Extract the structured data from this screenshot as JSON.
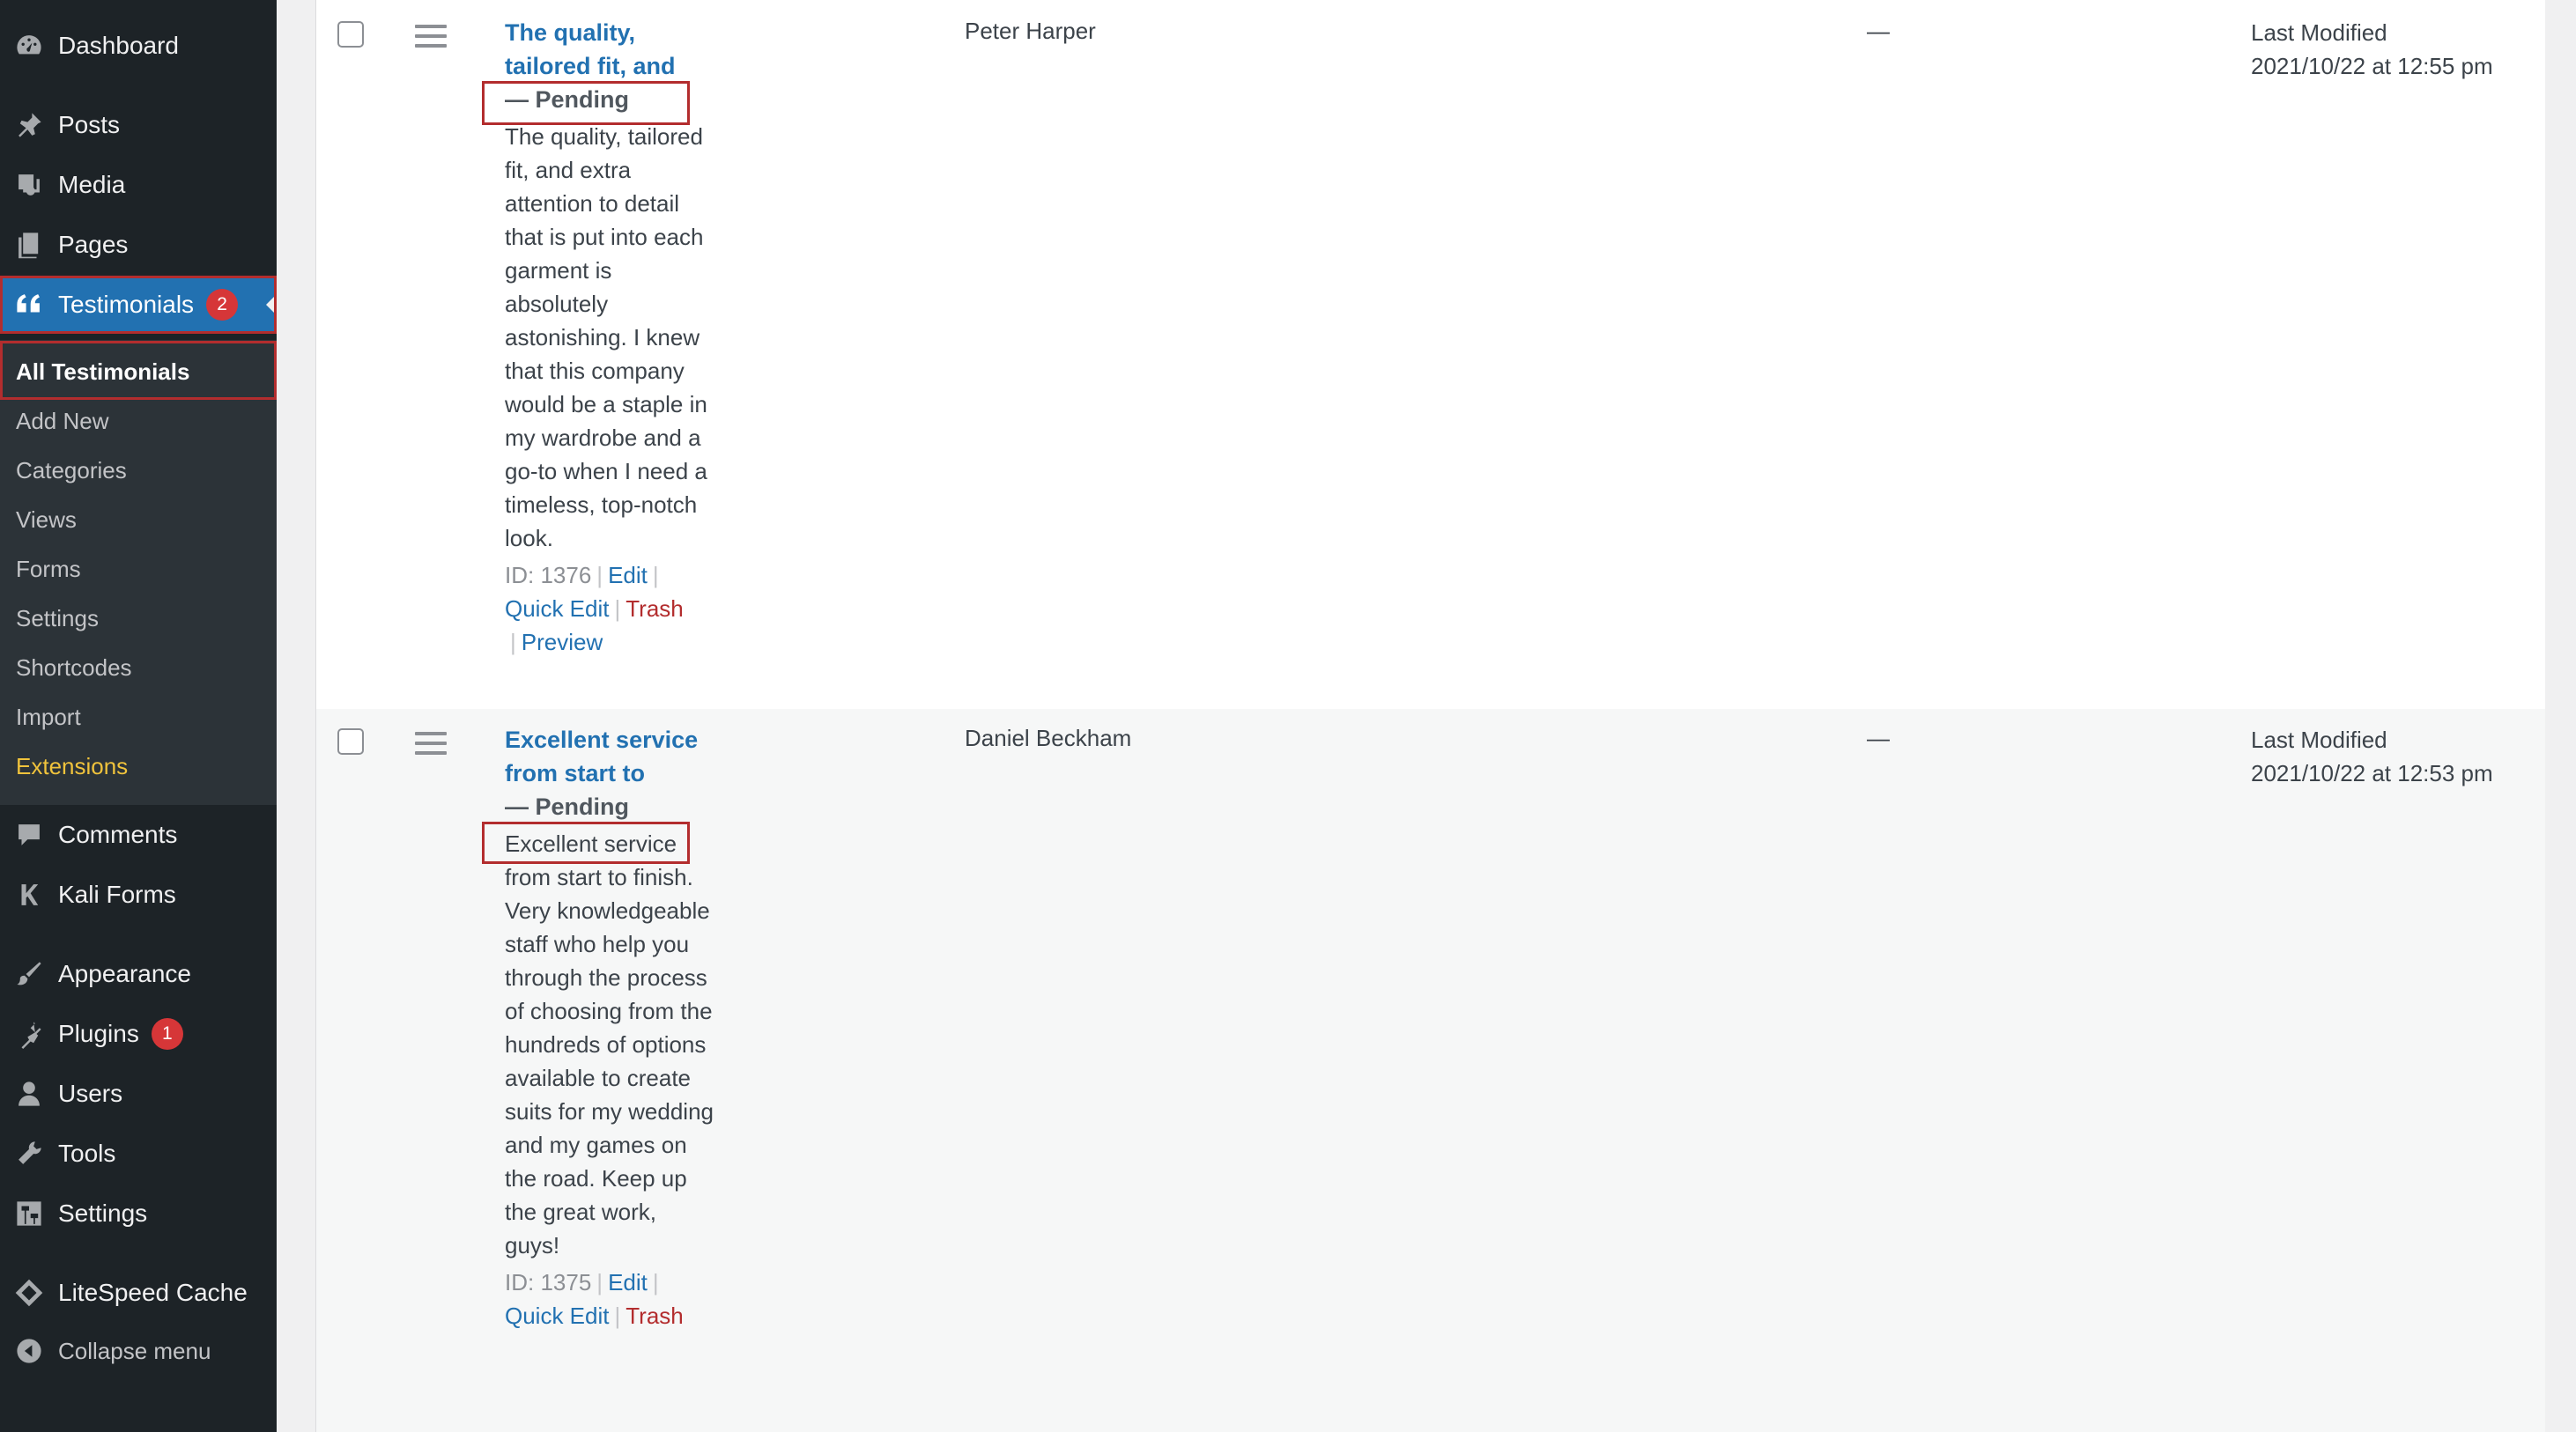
{
  "sidebar": {
    "items": [
      {
        "label": "Dashboard",
        "icon": "dashboard-icon"
      },
      {
        "label": "Posts",
        "icon": "pin-icon"
      },
      {
        "label": "Media",
        "icon": "media-icon"
      },
      {
        "label": "Pages",
        "icon": "pages-icon"
      },
      {
        "label": "Testimonials",
        "icon": "quote-icon",
        "badge": "2"
      },
      {
        "label": "Comments",
        "icon": "comment-icon"
      },
      {
        "label": "Kali Forms",
        "icon": "kali-k-icon"
      },
      {
        "label": "Appearance",
        "icon": "brush-icon"
      },
      {
        "label": "Plugins",
        "icon": "plugin-icon",
        "badge": "1"
      },
      {
        "label": "Users",
        "icon": "user-icon"
      },
      {
        "label": "Tools",
        "icon": "wrench-icon"
      },
      {
        "label": "Settings",
        "icon": "settings-icon"
      },
      {
        "label": "LiteSpeed Cache",
        "icon": "diamond-icon"
      },
      {
        "label": "Collapse menu",
        "icon": "collapse-icon"
      }
    ],
    "submenu": [
      "All Testimonials",
      "Add New",
      "Categories",
      "Views",
      "Forms",
      "Settings",
      "Shortcodes",
      "Import",
      "Extensions"
    ]
  },
  "rows": [
    {
      "title": "The quality, tailored fit, and",
      "state": "— Pending",
      "excerpt": "The quality, tailored fit, and extra attention to detail that is put into each garment is absolutely astonishing. I knew that this company would be a staple in my wardrobe and a go-to when I need a timeless, top-notch look.",
      "id_label": "ID: 1376",
      "edit": "Edit",
      "quick_edit": "Quick Edit",
      "trash": "Trash",
      "preview": "Preview",
      "author": "Peter Harper",
      "dash": "—",
      "date_label": "Last Modified",
      "date": "2021/10/22 at 12:55 pm"
    },
    {
      "title": "Excellent service from start to",
      "state": "— Pending",
      "excerpt": "Excellent service from start to finish. Very knowledgeable staff who help you through the process of choosing from the hundreds of options available to create suits for my wedding and my games on the road. Keep up the great work, guys!",
      "id_label": "ID: 1375",
      "edit": "Edit",
      "quick_edit": "Quick Edit",
      "trash": "Trash",
      "author": "Daniel Beckham",
      "dash": "—",
      "date_label": "Last Modified",
      "date": "2021/10/22 at 12:53 pm"
    }
  ],
  "colors": {
    "sidebar_bg": "#1d2327",
    "accent": "#2271b1",
    "badge": "#d63638",
    "highlight_box": "#b32d2e"
  }
}
